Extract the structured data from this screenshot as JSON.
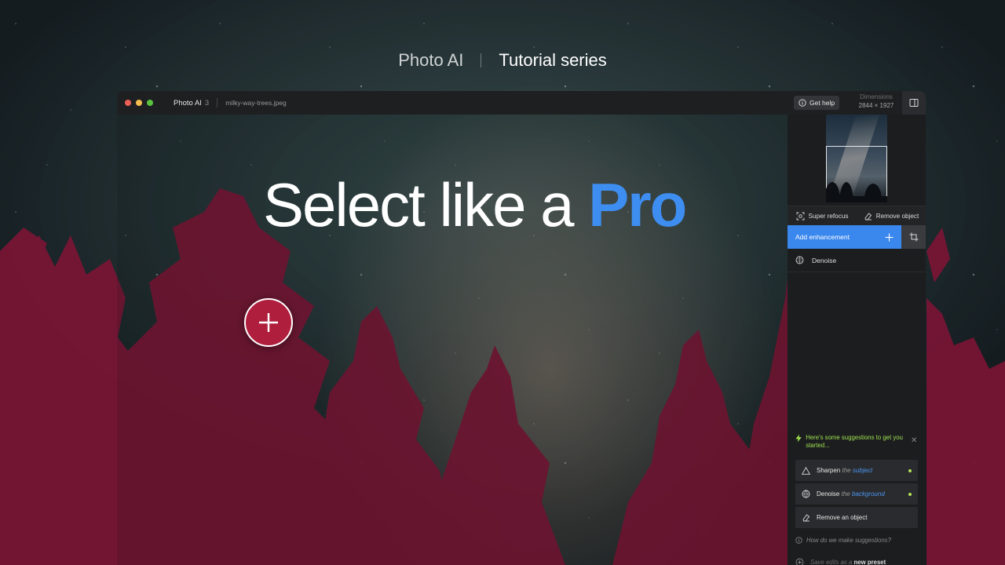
{
  "series_header": {
    "brand": "Photo AI",
    "title": "Tutorial series"
  },
  "titlebar": {
    "traffic_lights": [
      "#ec5f57",
      "#f4be4f",
      "#59c33f"
    ],
    "app_name": "Photo AI",
    "app_version": "3",
    "file_name": "milky-way-trees.jpeg",
    "help_label": "Get help",
    "dimensions_label": "Dimensions",
    "dimensions_value": "2844 × 1927"
  },
  "hero": {
    "text_plain": "Select like a ",
    "text_accent": "Pro",
    "accent_color": "#3d8ef0"
  },
  "marker": {
    "icon": "plus-icon",
    "color": "#b01e3d"
  },
  "panel": {
    "tools": [
      {
        "icon": "refocus-icon",
        "label": "Super refocus"
      },
      {
        "icon": "eraser-icon",
        "label": "Remove object"
      }
    ],
    "add_enhancement_label": "Add enhancement",
    "enhancements": [
      {
        "icon": "denoise-icon",
        "label": "Denoise"
      }
    ],
    "suggestions_title": "Here's some suggestions to get you started...",
    "suggestions": [
      {
        "icon": "triangle-icon",
        "verb": "Sharpen",
        "connector": "the",
        "target": "subject",
        "dot": true
      },
      {
        "icon": "globe-icon",
        "verb": "Denoise",
        "connector": "the",
        "target": "background",
        "dot": true
      },
      {
        "icon": "eraser-icon",
        "verb": "Remove an object",
        "connector": "",
        "target": "",
        "dot": false
      }
    ],
    "how_label": "How do we make suggestions?",
    "save_prefix": "Save edits as a",
    "save_action": "new preset"
  }
}
